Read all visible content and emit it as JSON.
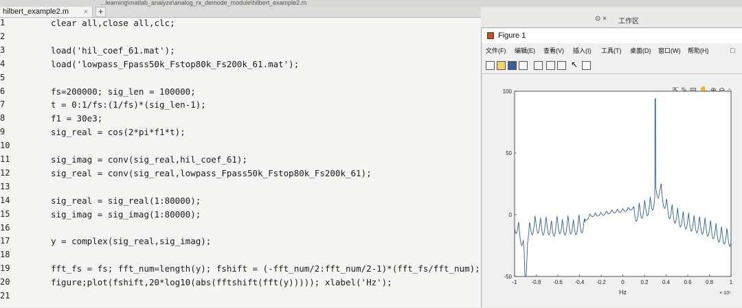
{
  "window": {
    "path": "...learning\\matlab_analyze\\analog_rx_demode_module\\hilbert_example2.m",
    "tab_label": "hilbert_example2.m",
    "tab_close": "×",
    "tab_add": "+",
    "workspace_label": "工作区",
    "panel_controls": "⊙ ×"
  },
  "editor": {
    "lines": [
      {
        "n": "1",
        "code": "clear all,close all,clc;"
      },
      {
        "n": "2",
        "code": ""
      },
      {
        "n": "3",
        "code": "load('hil_coef_61.mat');"
      },
      {
        "n": "4",
        "code": "load('lowpass_Fpass50k_Fstop80k_Fs200k_61.mat');"
      },
      {
        "n": "5",
        "code": ""
      },
      {
        "n": "6",
        "code": "fs=200000; sig_len = 100000;"
      },
      {
        "n": "7",
        "code": "t = 0:1/fs:(1/fs)*(sig_len-1);"
      },
      {
        "n": "8",
        "code": "f1 = 30e3;"
      },
      {
        "n": "9",
        "code": "sig_real = cos(2*pi*f1*t);"
      },
      {
        "n": "10",
        "code": ""
      },
      {
        "n": "11",
        "code": "sig_imag = conv(sig_real,hil_coef_61);"
      },
      {
        "n": "12",
        "code": "sig_real = conv(sig_real,lowpass_Fpass50k_Fstop80k_Fs200k_61);"
      },
      {
        "n": "13",
        "code": ""
      },
      {
        "n": "14",
        "code": "sig_real = sig_real(1:80000);"
      },
      {
        "n": "15",
        "code": "sig_imag = sig_imag(1:80000);"
      },
      {
        "n": "16",
        "code": ""
      },
      {
        "n": "17",
        "code": "y = complex(sig_real,sig_imag);"
      },
      {
        "n": "18",
        "code": ""
      },
      {
        "n": "19",
        "code": "fft_fs = fs; fft_num=length(y); fshift = (-fft_num/2:fft_num/2-1)*(fft_fs/fft_num);"
      },
      {
        "n": "20",
        "code": "figure;plot(fshift,20*log10(abs(fftshift(fft(y))))); xlabel('Hz');"
      },
      {
        "n": "21",
        "code": ""
      }
    ]
  },
  "figure": {
    "title": "Figure 1",
    "close_glyph": "□",
    "menus": [
      "文件(F)",
      "编辑(E)",
      "查看(V)",
      "插入(I)",
      "工具(T)",
      "桌面(D)",
      "窗口(W)",
      "帮助(H)"
    ],
    "axes_toolbar_icons": [
      "export-icon",
      "brush-icon",
      "datatip-icon",
      "pan-icon",
      "zoom-in-icon",
      "zoom-out-icon",
      "home-icon"
    ],
    "colors": {
      "line": "#2a5f8f",
      "axes_bg": "#ffffff",
      "figure_bg": "#f0f0f0"
    }
  },
  "chart_data": {
    "type": "line",
    "xlabel": "Hz",
    "x_exponent": "× 10⁵",
    "xlim": [
      -1,
      1
    ],
    "ylim": [
      -50,
      100
    ],
    "xticks": [
      "-1",
      "-0.8",
      "-0.6",
      "-0.4",
      "-0.2",
      "0",
      "0.2",
      "0.4",
      "0.6",
      "0.8",
      "1"
    ],
    "yticks": [
      "-50",
      "0",
      "50",
      "100"
    ],
    "series": [
      {
        "x": [
          -1.0,
          -0.98,
          -0.95,
          -0.92,
          -0.9,
          -0.88,
          -0.85,
          -0.8,
          -0.75,
          -0.7,
          -0.65,
          -0.6,
          -0.55,
          -0.5,
          -0.45,
          -0.4,
          -0.35,
          -0.3,
          -0.2,
          -0.1,
          0.0,
          0.1,
          0.15,
          0.2,
          0.25,
          0.28,
          0.3,
          0.32,
          0.34,
          0.36,
          0.38,
          0.4,
          0.45,
          0.5,
          0.55,
          0.6,
          0.65,
          0.7,
          0.75,
          0.8,
          0.85,
          0.9,
          0.95,
          1.0
        ],
        "y": [
          0,
          -2,
          -8,
          -14,
          -50,
          -10,
          -3,
          0,
          -3,
          -1,
          -5,
          0,
          -4,
          0,
          -4,
          1,
          -3,
          1,
          2,
          4,
          5,
          7,
          10,
          12,
          14,
          18,
          22,
          26,
          30,
          24,
          20,
          14,
          9,
          6,
          3,
          2,
          0,
          -1,
          -2,
          -4,
          -6,
          -9,
          -10,
          -12
        ],
        "peak": {
          "x": 0.3,
          "y": 94
        }
      }
    ]
  }
}
